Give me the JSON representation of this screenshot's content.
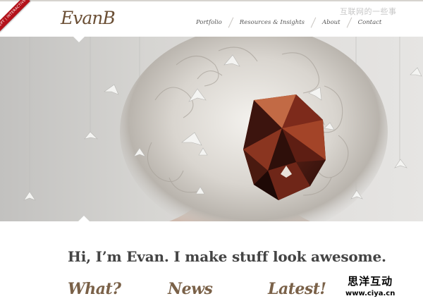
{
  "header": {
    "ribbon_text": "SEPT | INTERACTIVE",
    "logo": "EvanB",
    "nav": [
      {
        "label": "Portfolio"
      },
      {
        "label": "Resources & Insights"
      },
      {
        "label": "About"
      },
      {
        "label": "Contact"
      }
    ],
    "watermark": "互联网的一些事"
  },
  "content": {
    "tagline": "Hi, I’m Evan. I make stuff look awesome.",
    "sections": [
      {
        "title": "What?"
      },
      {
        "title": "News"
      },
      {
        "title": "Latest!"
      }
    ]
  },
  "watermark_bottom": {
    "chinese": "思洋互动",
    "url": "www.ciya.cn"
  },
  "colors": {
    "logo": "#6b4f35",
    "ribbon": "#b3111a",
    "section_title": "#7a6148"
  }
}
